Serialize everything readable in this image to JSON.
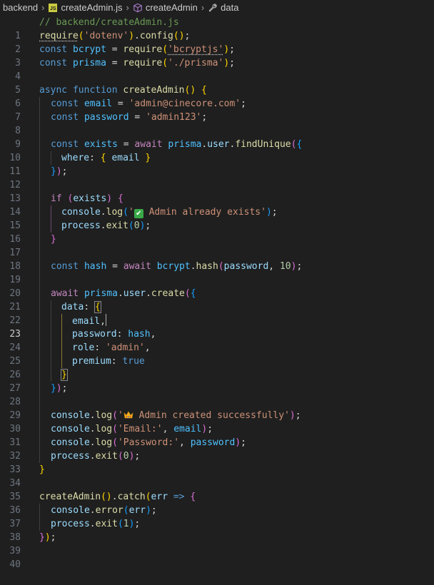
{
  "breadcrumb": {
    "folder": "backend",
    "file": "createAdmin.js",
    "symbol": "createAdmin",
    "property": "data",
    "icons": [
      "js-file-icon",
      "cube-icon",
      "wrench-icon"
    ]
  },
  "editor": {
    "active_line": 23,
    "line_numbers": [
      "1",
      "2",
      "3",
      "4",
      "5",
      "6",
      "7",
      "8",
      "9",
      "10",
      "11",
      "12",
      "13",
      "14",
      "15",
      "16",
      "17",
      "18",
      "19",
      "20",
      "21",
      "22",
      "23",
      "24",
      "25",
      "26",
      "27",
      "28",
      "29",
      "30",
      "31",
      "32",
      "33",
      "34",
      "35",
      "36",
      "37",
      "38",
      "39",
      "40"
    ],
    "tokens": {
      "l1": "// backend/createAdmin.js",
      "l2_fn": "require",
      "l2_p1": "(",
      "l2_str": "'dotenv'",
      "l2_p1c": ")",
      "l2_dot": ".",
      "l2_fn2": "config",
      "l2_p1b": "()",
      "l2_semi": ";",
      "l3_kw": "const",
      "l3_var": " bcrypt",
      "l3_eq": " = ",
      "l3_fn": "require",
      "l3_p1": "(",
      "l3_str": "'bcryptjs'",
      "l3_p1c": ")",
      "l3_semi": ";",
      "l4_kw": "const",
      "l4_var": " prisma",
      "l4_eq": " = ",
      "l4_fn": "require",
      "l4_p1": "(",
      "l4_str": "'./prisma'",
      "l4_p1c": ")",
      "l4_semi": ";",
      "l6_kw1": "async",
      "l6_kw2": " function",
      "l6_fn": " createAdmin",
      "l6_p1": "()",
      "l6_sp": " ",
      "l6_br": "{",
      "l7_kw": "const",
      "l7_var": " email",
      "l7_eq": " = ",
      "l7_str": "'admin@cinecore.com'",
      "l7_semi": ";",
      "l8_kw": "const",
      "l8_var": " password",
      "l8_eq": " = ",
      "l8_str": "'admin123'",
      "l8_semi": ";",
      "l10_kw": "const",
      "l10_var": " exists",
      "l10_eq": " = ",
      "l10_ctl": "await",
      "l10_v2": " prisma",
      "l10_d": ".",
      "l10_v3": "user",
      "l10_d2": ".",
      "l10_fn": "findUnique",
      "l10_p2": "(",
      "l10_p3": "{",
      "l11_var": "where",
      "l11_col": ": ",
      "l11_p1": "{",
      "l11_v2": " email ",
      "l11_p1c": "}",
      "l12_p3": "}",
      "l12_p2": ")",
      "l12_semi": ";",
      "l14_ctl": "if",
      "l14_sp": " ",
      "l14_p2": "(",
      "l14_var": "exists",
      "l14_p2c": ")",
      "l14_sp2": " ",
      "l14_p2b": "{",
      "l15_var": "console",
      "l15_d": ".",
      "l15_fn": "log",
      "l15_p3": "(",
      "l15_str1": "'",
      "l15_str2": " Admin already exists'",
      "l15_p3c": ")",
      "l15_semi": ";",
      "l16_var": "process",
      "l16_d": ".",
      "l16_fn": "exit",
      "l16_p3": "(",
      "l16_num": "0",
      "l16_p3c": ")",
      "l16_semi": ";",
      "l17_p2": "}",
      "l19_kw": "const",
      "l19_var": " hash",
      "l19_eq": " = ",
      "l19_ctl": "await",
      "l19_v2": " bcrypt",
      "l19_d": ".",
      "l19_fn": "hash",
      "l19_p2": "(",
      "l19_v3": "password",
      "l19_c": ", ",
      "l19_num": "10",
      "l19_p2c": ")",
      "l19_semi": ";",
      "l21_ctl": "await",
      "l21_v2": " prisma",
      "l21_d": ".",
      "l21_v3": "user",
      "l21_d2": ".",
      "l21_fn": "create",
      "l21_p2": "(",
      "l21_p3": "{",
      "l22_var": "data",
      "l22_col": ": ",
      "l22_p1": "{",
      "l23_var": "email",
      "l23_c": ",",
      "l24_var": "password",
      "l24_col": ": ",
      "l24_v2": "hash",
      "l24_c": ",",
      "l25_var": "role",
      "l25_col": ": ",
      "l25_str": "'admin'",
      "l25_c": ",",
      "l26_var": "premium",
      "l26_col": ": ",
      "l26_kw": "true",
      "l27_p1": "}",
      "l28_p3": "}",
      "l28_p2": ")",
      "l28_semi": ";",
      "l30_var": "console",
      "l30_d": ".",
      "l30_fn": "log",
      "l30_p2": "(",
      "l30_str1": "'",
      "l30_str2": " Admin created successfully'",
      "l30_p2c": ")",
      "l30_semi": ";",
      "l31_var": "console",
      "l31_d": ".",
      "l31_fn": "log",
      "l31_p2": "(",
      "l31_str": "'Email:'",
      "l31_c": ", ",
      "l31_v2": "email",
      "l31_p2c": ")",
      "l31_semi": ";",
      "l32_var": "console",
      "l32_d": ".",
      "l32_fn": "log",
      "l32_p2": "(",
      "l32_str": "'Password:'",
      "l32_c": ", ",
      "l32_v2": "password",
      "l32_p2c": ")",
      "l32_semi": ";",
      "l33_var": "process",
      "l33_d": ".",
      "l33_fn": "exit",
      "l33_p2": "(",
      "l33_num": "0",
      "l33_p2c": ")",
      "l33_semi": ";",
      "l34_br": "}",
      "l36_fn": "createAdmin",
      "l36_p1": "()",
      "l36_d": ".",
      "l36_fn2": "catch",
      "l36_p1b": "(",
      "l36_var": "err",
      "l36_arrow": " => ",
      "l36_p2": "{",
      "l37_var": "console",
      "l37_d": ".",
      "l37_fn": "error",
      "l37_p3": "(",
      "l37_v2": "err",
      "l37_p3c": ")",
      "l37_semi": ";",
      "l38_var": "process",
      "l38_d": ".",
      "l38_fn": "exit",
      "l38_p3": "(",
      "l38_num": "1",
      "l38_p3c": ")",
      "l38_semi": ";",
      "l39_p2": "}",
      "l39_p1": ")",
      "l39_semi": ";"
    }
  },
  "colors": {
    "background": "#1f1f1f",
    "comment": "#6a9955",
    "string": "#ce9178",
    "keyword": "#569cd6",
    "control": "#c586c0",
    "variable": "#9cdcfe",
    "function": "#dcdcaa",
    "number": "#b5cea8",
    "bracket1": "#ffd700",
    "bracket2": "#da70d6",
    "bracket3": "#179fff"
  }
}
